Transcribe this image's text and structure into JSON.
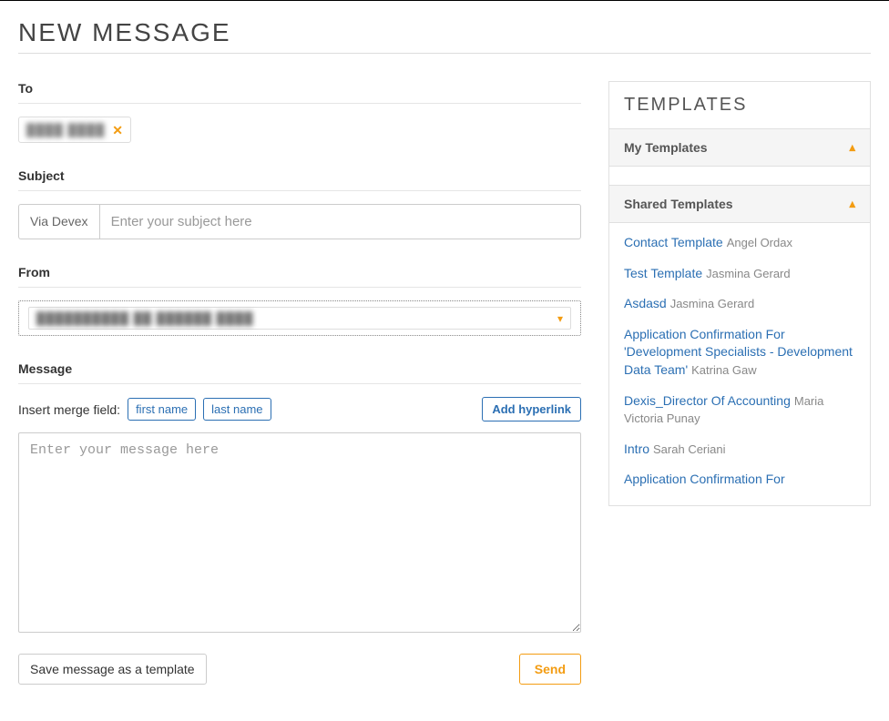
{
  "page": {
    "title": "NEW MESSAGE"
  },
  "to": {
    "label": "To",
    "chips": [
      {
        "text": "████  ████"
      }
    ]
  },
  "subject": {
    "label": "Subject",
    "prefix": "Via Devex",
    "placeholder": "Enter your subject here",
    "value": ""
  },
  "from": {
    "label": "From",
    "display": "██████████   ██  ██████   ████"
  },
  "message": {
    "label": "Message",
    "mergeLabel": "Insert merge field:",
    "mergeFields": {
      "first": "first name",
      "last": "last name"
    },
    "hyperlink": "Add hyperlink",
    "placeholder": "Enter your message here",
    "value": ""
  },
  "actions": {
    "saveTemplate": "Save message as a template",
    "send": "Send"
  },
  "templates": {
    "title": "TEMPLATES",
    "my": {
      "label": "My Templates",
      "expanded": true,
      "items": []
    },
    "shared": {
      "label": "Shared Templates",
      "expanded": true,
      "items": [
        {
          "name": "Contact Template",
          "author": "Angel Ordax"
        },
        {
          "name": "Test Template",
          "author": "Jasmina Gerard"
        },
        {
          "name": "Asdasd",
          "author": "Jasmina Gerard"
        },
        {
          "name": "Application Confirmation For 'Development Specialists - Development Data Team'",
          "author": "Katrina Gaw"
        },
        {
          "name": "Dexis_Director Of Accounting",
          "author": "Maria Victoria Punay"
        },
        {
          "name": "Intro",
          "author": "Sarah Ceriani"
        },
        {
          "name": "Application Confirmation For",
          "author": ""
        }
      ]
    }
  }
}
